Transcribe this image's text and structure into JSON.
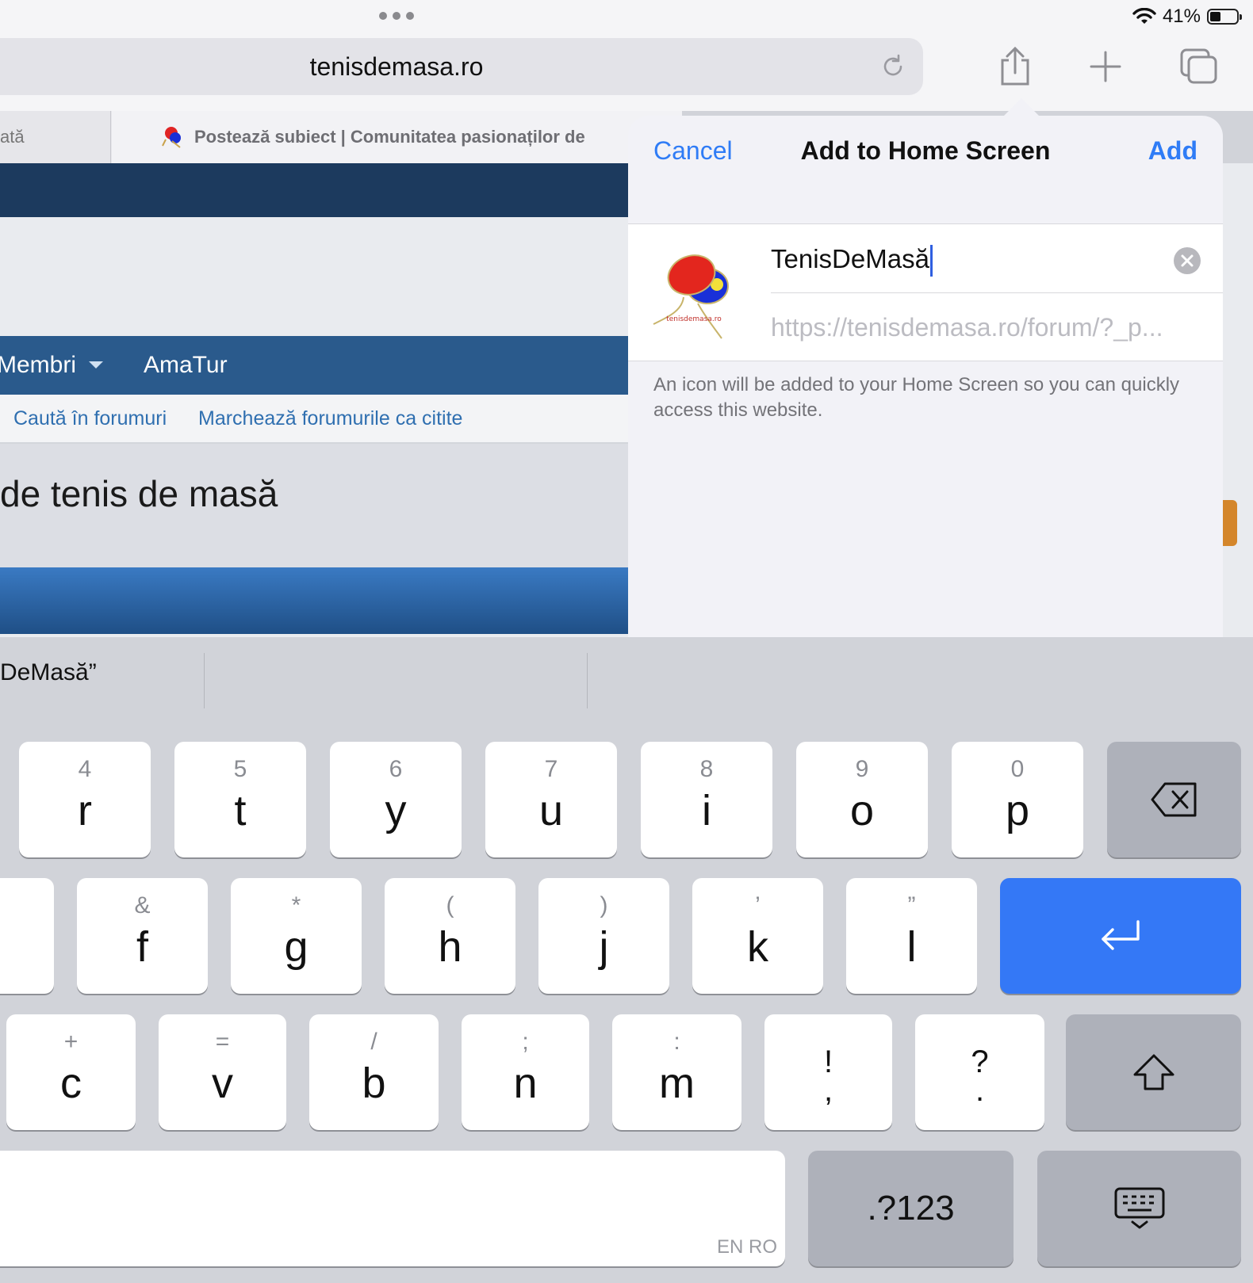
{
  "status_bar": {
    "battery_percent": "41%",
    "battery_level": 0.41
  },
  "toolbar": {
    "url": "tenisdemasa.ro"
  },
  "tabs": [
    {
      "label": "ată"
    },
    {
      "label": "Postează subiect | Comunitatea pasionaților de"
    }
  ],
  "page": {
    "nav": [
      "Membri",
      "AmaTur"
    ],
    "sub_links": [
      "Caută în forumuri",
      "Marchează forumurile ca citite"
    ],
    "hero_title": "de tenis de masă"
  },
  "dialog": {
    "cancel": "Cancel",
    "title": "Add to Home Screen",
    "add": "Add",
    "icon_text": "tenisdemasa.ro",
    "name_value": "TenisDeMasă",
    "url_value": "https://tenisdemasa.ro/forum/?_p...",
    "note": "An icon will be added to your Home Screen so you can quickly access this website."
  },
  "keyboard": {
    "prediction": "DeMasă”",
    "row1": [
      {
        "sec": "4",
        "pri": "r"
      },
      {
        "sec": "5",
        "pri": "t"
      },
      {
        "sec": "6",
        "pri": "y"
      },
      {
        "sec": "7",
        "pri": "u"
      },
      {
        "sec": "8",
        "pri": "i"
      },
      {
        "sec": "9",
        "pri": "o"
      },
      {
        "sec": "0",
        "pri": "p"
      }
    ],
    "row2": [
      {
        "sec": "&",
        "pri": "f"
      },
      {
        "sec": "*",
        "pri": "g"
      },
      {
        "sec": "(",
        "pri": "h"
      },
      {
        "sec": ")",
        "pri": "j"
      },
      {
        "sec": "’",
        "pri": "k"
      },
      {
        "sec": "”",
        "pri": "l"
      }
    ],
    "row3": [
      {
        "sec": "+",
        "pri": "c"
      },
      {
        "sec": "=",
        "pri": "v"
      },
      {
        "sec": "/",
        "pri": "b"
      },
      {
        "sec": ";",
        "pri": "n"
      },
      {
        "sec": ":",
        "pri": "m"
      }
    ],
    "punct1": {
      "top": "!",
      "bottom": ","
    },
    "punct2": {
      "top": "?",
      "bottom": "."
    },
    "numbers_key": ".?123",
    "space_lang": "EN RO"
  }
}
